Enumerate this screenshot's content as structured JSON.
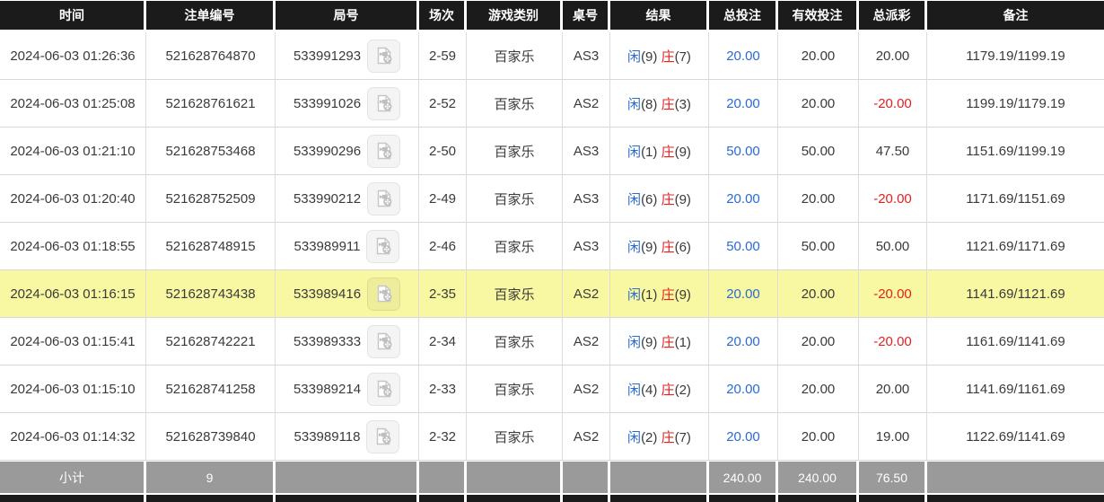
{
  "table": {
    "columns": [
      "时间",
      "注单编号",
      "局号",
      "场次",
      "游戏类别",
      "桌号",
      "结果",
      "总投注",
      "有效投注",
      "总派彩",
      "备注"
    ],
    "rows": [
      {
        "time": "2024-06-03 01:26:36",
        "bet_no": "521628764870",
        "round_no": "533991293",
        "session": "2-59",
        "game": "百家乐",
        "table_no": "AS3",
        "result": {
          "player": "闲",
          "player_score": "(9)",
          "banker": "庄",
          "banker_score": "(7)"
        },
        "total_bet": "20.00",
        "valid_bet": "20.00",
        "payout": "20.00",
        "remark": "1179.19/1199.19",
        "highlight": false
      },
      {
        "time": "2024-06-03 01:25:08",
        "bet_no": "521628761621",
        "round_no": "533991026",
        "session": "2-52",
        "game": "百家乐",
        "table_no": "AS2",
        "result": {
          "player": "闲",
          "player_score": "(8)",
          "banker": "庄",
          "banker_score": "(3)"
        },
        "total_bet": "20.00",
        "valid_bet": "20.00",
        "payout": "-20.00",
        "remark": "1199.19/1179.19",
        "highlight": false
      },
      {
        "time": "2024-06-03 01:21:10",
        "bet_no": "521628753468",
        "round_no": "533990296",
        "session": "2-50",
        "game": "百家乐",
        "table_no": "AS3",
        "result": {
          "player": "闲",
          "player_score": "(1)",
          "banker": "庄",
          "banker_score": "(9)"
        },
        "total_bet": "50.00",
        "valid_bet": "50.00",
        "payout": "47.50",
        "remark": "1151.69/1199.19",
        "highlight": false
      },
      {
        "time": "2024-06-03 01:20:40",
        "bet_no": "521628752509",
        "round_no": "533990212",
        "session": "2-49",
        "game": "百家乐",
        "table_no": "AS3",
        "result": {
          "player": "闲",
          "player_score": "(6)",
          "banker": "庄",
          "banker_score": "(9)"
        },
        "total_bet": "20.00",
        "valid_bet": "20.00",
        "payout": "-20.00",
        "remark": "1171.69/1151.69",
        "highlight": false
      },
      {
        "time": "2024-06-03 01:18:55",
        "bet_no": "521628748915",
        "round_no": "533989911",
        "session": "2-46",
        "game": "百家乐",
        "table_no": "AS3",
        "result": {
          "player": "闲",
          "player_score": "(9)",
          "banker": "庄",
          "banker_score": "(6)"
        },
        "total_bet": "50.00",
        "valid_bet": "50.00",
        "payout": "50.00",
        "remark": "1121.69/1171.69",
        "highlight": false
      },
      {
        "time": "2024-06-03 01:16:15",
        "bet_no": "521628743438",
        "round_no": "533989416",
        "session": "2-35",
        "game": "百家乐",
        "table_no": "AS2",
        "result": {
          "player": "闲",
          "player_score": "(1)",
          "banker": "庄",
          "banker_score": "(9)"
        },
        "total_bet": "20.00",
        "valid_bet": "20.00",
        "payout": "-20.00",
        "remark": "1141.69/1121.69",
        "highlight": true
      },
      {
        "time": "2024-06-03 01:15:41",
        "bet_no": "521628742221",
        "round_no": "533989333",
        "session": "2-34",
        "game": "百家乐",
        "table_no": "AS2",
        "result": {
          "player": "闲",
          "player_score": "(9)",
          "banker": "庄",
          "banker_score": "(1)"
        },
        "total_bet": "20.00",
        "valid_bet": "20.00",
        "payout": "-20.00",
        "remark": "1161.69/1141.69",
        "highlight": false
      },
      {
        "time": "2024-06-03 01:15:10",
        "bet_no": "521628741258",
        "round_no": "533989214",
        "session": "2-33",
        "game": "百家乐",
        "table_no": "AS2",
        "result": {
          "player": "闲",
          "player_score": "(4)",
          "banker": "庄",
          "banker_score": "(2)"
        },
        "total_bet": "20.00",
        "valid_bet": "20.00",
        "payout": "20.00",
        "remark": "1141.69/1161.69",
        "highlight": false
      },
      {
        "time": "2024-06-03 01:14:32",
        "bet_no": "521628739840",
        "round_no": "533989118",
        "session": "2-32",
        "game": "百家乐",
        "table_no": "AS2",
        "result": {
          "player": "闲",
          "player_score": "(2)",
          "banker": "庄",
          "banker_score": "(7)"
        },
        "total_bet": "20.00",
        "valid_bet": "20.00",
        "payout": "19.00",
        "remark": "1122.69/1141.69",
        "highlight": false
      }
    ],
    "subtotal": {
      "label": "小计",
      "count": "9",
      "total_bet": "240.00",
      "valid_bet": "240.00",
      "payout": "76.50"
    }
  },
  "icons": {
    "round_video": "video-file-icon"
  },
  "colors": {
    "header_bg": "#1b1b1b",
    "highlight_row": "#f8f8a2",
    "bet_blue": "#2a6ad2",
    "loss_red": "#e02222",
    "subtotal_bg": "#9a9a9a",
    "grid_line": "#dcdcdc"
  }
}
